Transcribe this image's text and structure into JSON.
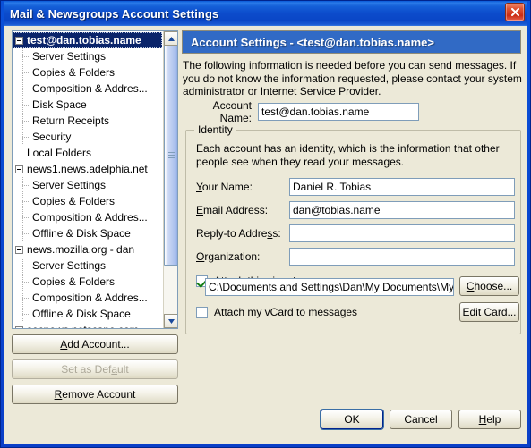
{
  "window": {
    "title": "Mail & Newsgroups Account Settings",
    "close_icon": "close-icon"
  },
  "tree": {
    "items": [
      {
        "label": "test@dan.tobias.name",
        "level": 0,
        "expander": "minus",
        "selected": true
      },
      {
        "label": "Server Settings",
        "level": 1,
        "expander": "none",
        "selected": false
      },
      {
        "label": "Copies & Folders",
        "level": 1,
        "expander": "none",
        "selected": false
      },
      {
        "label": "Composition & Addres...",
        "level": 1,
        "expander": "none",
        "selected": false
      },
      {
        "label": "Disk Space",
        "level": 1,
        "expander": "none",
        "selected": false
      },
      {
        "label": "Return Receipts",
        "level": 1,
        "expander": "none",
        "selected": false
      },
      {
        "label": "Security",
        "level": 1,
        "expander": "none",
        "selected": false
      },
      {
        "label": "Local Folders",
        "level": 0,
        "expander": "blank",
        "selected": false
      },
      {
        "label": "news1.news.adelphia.net",
        "level": 0,
        "expander": "minus",
        "selected": false
      },
      {
        "label": "Server Settings",
        "level": 1,
        "expander": "none",
        "selected": false
      },
      {
        "label": "Copies & Folders",
        "level": 1,
        "expander": "none",
        "selected": false
      },
      {
        "label": "Composition & Addres...",
        "level": 1,
        "expander": "none",
        "selected": false
      },
      {
        "label": "Offline & Disk Space",
        "level": 1,
        "expander": "none",
        "selected": false
      },
      {
        "label": "news.mozilla.org - dan",
        "level": 0,
        "expander": "minus",
        "selected": false
      },
      {
        "label": "Server Settings",
        "level": 1,
        "expander": "none",
        "selected": false
      },
      {
        "label": "Copies & Folders",
        "level": 1,
        "expander": "none",
        "selected": false
      },
      {
        "label": "Composition & Addres...",
        "level": 1,
        "expander": "none",
        "selected": false
      },
      {
        "label": "Offline & Disk Space",
        "level": 1,
        "expander": "none",
        "selected": false
      },
      {
        "label": "secnews.netscape.com - ...",
        "level": 0,
        "expander": "minus",
        "selected": false
      }
    ]
  },
  "left_buttons": {
    "add_account": "Add Account...",
    "set_as_default": "Set as Default",
    "remove_account": "Remove Account"
  },
  "panel": {
    "header": "Account Settings - <test@dan.tobias.name>",
    "intro": "The following information is needed before you can send messages. If you do not know the information requested, please contact your system administrator or Internet Service Provider.",
    "account_name_label": "Account Name:",
    "account_name_value": "test@dan.tobias.name"
  },
  "identity": {
    "legend": "Identity",
    "description": "Each account has an identity, which is the information that other people see when they read your messages.",
    "your_name_label": "Your Name:",
    "your_name_value": "Daniel R. Tobias",
    "email_label": "Email Address:",
    "email_value": "dan@tobias.name",
    "reply_to_label": "Reply-to Address:",
    "reply_to_value": "",
    "organization_label": "Organization:",
    "organization_value": "",
    "attach_signature_label": "Attach this signature:",
    "attach_signature_checked": true,
    "signature_path": "C:\\Documents and Settings\\Dan\\My Documents\\My Te",
    "choose_button": "Choose...",
    "attach_vcard_label": "Attach my vCard to messages",
    "attach_vcard_checked": false,
    "edit_card_button": "Edit Card..."
  },
  "dialog_buttons": {
    "ok": "OK",
    "cancel": "Cancel",
    "help": "Help"
  },
  "colors": {
    "title_blue": "#0a3fc8",
    "header_blue": "#316ac5",
    "dialog_face": "#ece9d8",
    "selection_blue": "#0a246a",
    "field_border": "#7f9db9",
    "close_red": "#c92c14",
    "check_green": "#137d13"
  }
}
